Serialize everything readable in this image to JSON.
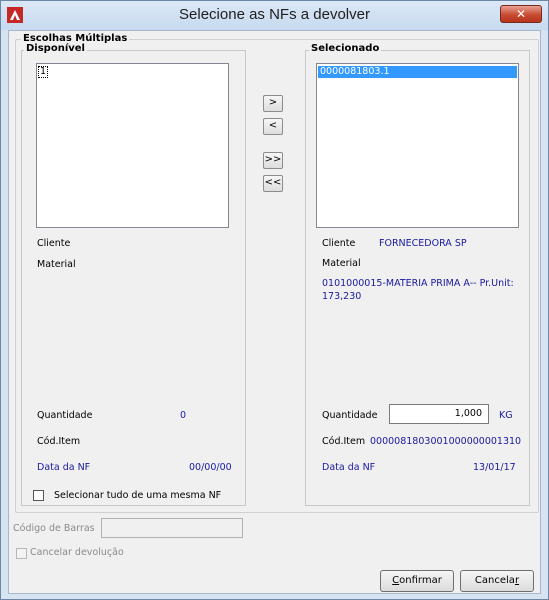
{
  "window": {
    "title": "Selecione as NFs a devolver",
    "close_glyph": "✕",
    "accent": "#c74b32"
  },
  "group": {
    "title": "Escolhas Múltiplas"
  },
  "available": {
    "title": "Disponível",
    "items": [
      "1"
    ],
    "cliente_label": "Cliente",
    "material_label": "Material",
    "quantidade_label": "Quantidade",
    "quantidade_value": "0",
    "cod_item_label": "Cód.Item",
    "data_nf_label": "Data da NF",
    "data_nf_value": "00/00/00"
  },
  "selected": {
    "title": "Selecionado",
    "items": [
      "0000081803.1"
    ],
    "cliente_label": "Cliente",
    "cliente_value": "FORNECEDORA SP",
    "material_label": "Material",
    "material_value_line1": "0101000015-MATERIA PRIMA A-- Pr.Unit:",
    "material_value_line2": "173,230",
    "quantidade_label": "Quantidade",
    "quantidade_value": "1,000",
    "unit": "KG",
    "cod_item_label": "Cód.Item",
    "cod_item_value": "0000081803001000000001310",
    "data_nf_label": "Data da NF",
    "data_nf_value": "13/01/17"
  },
  "move_buttons": {
    "add_one": ">",
    "remove_one": "<",
    "add_all": ">>",
    "remove_all": "<<"
  },
  "select_all_same_nf": {
    "label": "Selecionar tudo de uma mesma NF",
    "checked": false
  },
  "barcode": {
    "label": "Código de Barras",
    "value": ""
  },
  "cancel_return": {
    "label": "Cancelar devolução",
    "checked": false
  },
  "buttons": {
    "confirm_pre": "",
    "confirm_u": "C",
    "confirm_post": "onfirmar",
    "cancel_pre": "Cancela",
    "cancel_u": "r",
    "cancel_post": ""
  }
}
